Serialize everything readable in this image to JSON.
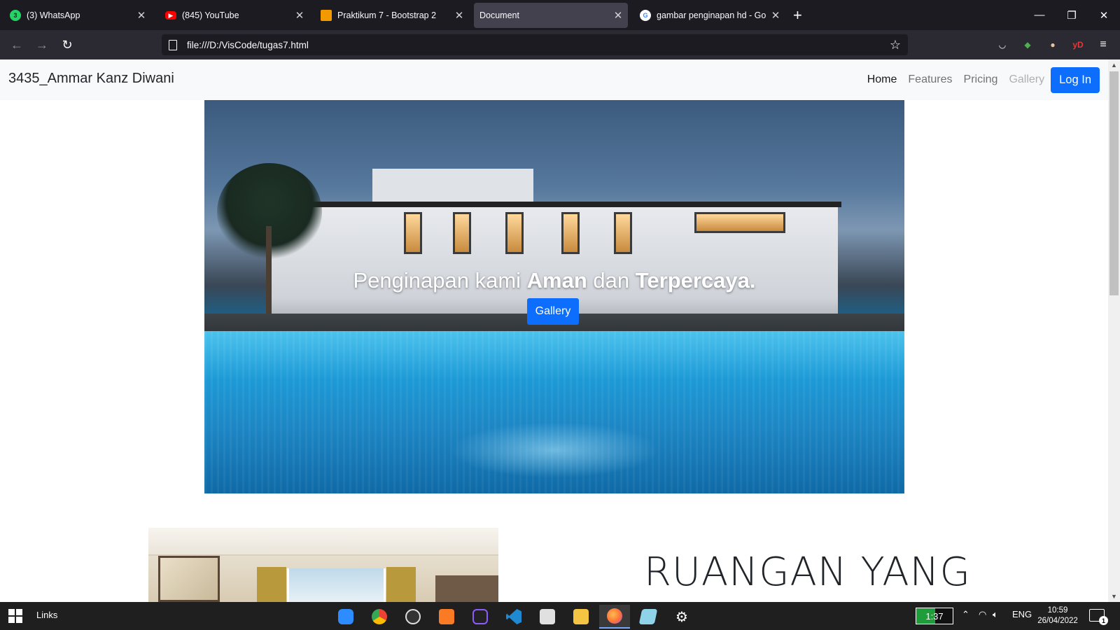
{
  "browser": {
    "tabs": [
      {
        "title": "(3) WhatsApp",
        "icon": "whatsapp-icon",
        "color": "#25d366",
        "badge": "3"
      },
      {
        "title": "(845) YouTube",
        "icon": "youtube-icon",
        "color": "#ff0000",
        "badge": ""
      },
      {
        "title": "Praktikum 7 - Bootstrap 2",
        "icon": "classroom-icon",
        "color": "#f29900",
        "badge": ""
      },
      {
        "title": "Document",
        "icon": "",
        "color": "",
        "badge": ""
      },
      {
        "title": "gambar penginapan hd - Googl",
        "icon": "google-icon",
        "color": "#ffffff",
        "badge": "G"
      }
    ],
    "url": "file:///D:/VisCode/tugas7.html"
  },
  "site": {
    "brand": "3435_Ammar Kanz Diwani",
    "nav": [
      "Home",
      "Features",
      "Pricing",
      "Gallery"
    ],
    "login": "Log In",
    "hero": {
      "caption_pre": "Penginapan kami ",
      "caption_b1": "Aman",
      "caption_mid": " dan ",
      "caption_b2": "Terpercaya.",
      "button": "Gallery"
    },
    "section_title": "RUANGAN YANG"
  },
  "taskbar": {
    "links": "Links",
    "battery": "1:37",
    "lang": "ENG",
    "time": "10:59",
    "date": "26/04/2022",
    "notifications": "1"
  }
}
